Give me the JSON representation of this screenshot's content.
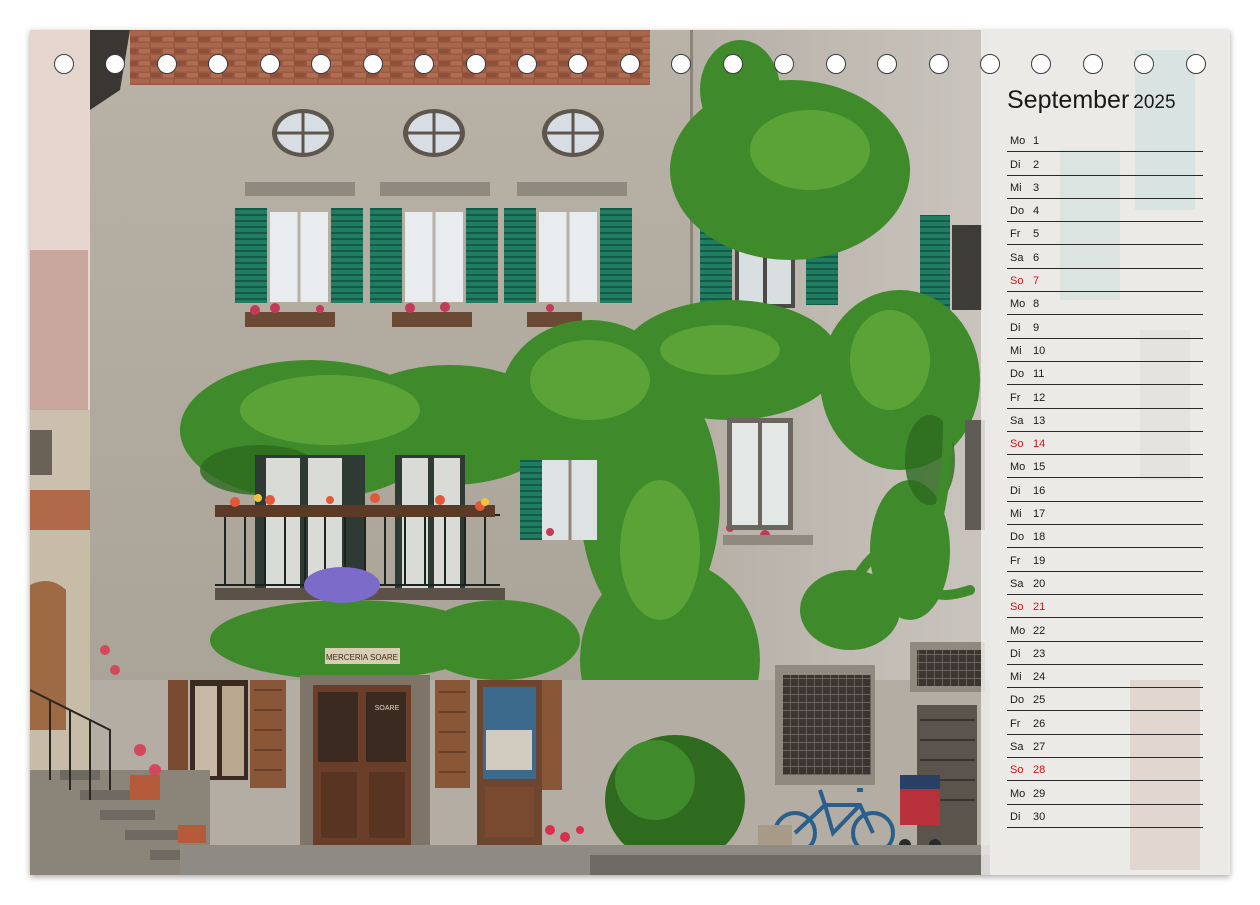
{
  "calendar": {
    "month": "September",
    "year": "2025",
    "days": [
      {
        "dow": "Mo",
        "num": "1"
      },
      {
        "dow": "Di",
        "num": "2"
      },
      {
        "dow": "Mi",
        "num": "3"
      },
      {
        "dow": "Do",
        "num": "4"
      },
      {
        "dow": "Fr",
        "num": "5"
      },
      {
        "dow": "Sa",
        "num": "6"
      },
      {
        "dow": "So",
        "num": "7",
        "sunday": true
      },
      {
        "dow": "Mo",
        "num": "8"
      },
      {
        "dow": "Di",
        "num": "9"
      },
      {
        "dow": "Mi",
        "num": "10"
      },
      {
        "dow": "Do",
        "num": "11"
      },
      {
        "dow": "Fr",
        "num": "12"
      },
      {
        "dow": "Sa",
        "num": "13"
      },
      {
        "dow": "So",
        "num": "14",
        "sunday": true
      },
      {
        "dow": "Mo",
        "num": "15"
      },
      {
        "dow": "Di",
        "num": "16"
      },
      {
        "dow": "Mi",
        "num": "17"
      },
      {
        "dow": "Do",
        "num": "18"
      },
      {
        "dow": "Fr",
        "num": "19"
      },
      {
        "dow": "Sa",
        "num": "20"
      },
      {
        "dow": "So",
        "num": "21",
        "sunday": true
      },
      {
        "dow": "Mo",
        "num": "22"
      },
      {
        "dow": "Di",
        "num": "23"
      },
      {
        "dow": "Mi",
        "num": "24"
      },
      {
        "dow": "Do",
        "num": "25"
      },
      {
        "dow": "Fr",
        "num": "26"
      },
      {
        "dow": "Sa",
        "num": "27"
      },
      {
        "dow": "So",
        "num": "28",
        "sunday": true
      },
      {
        "dow": "Mo",
        "num": "29"
      },
      {
        "dow": "Di",
        "num": "30"
      }
    ]
  },
  "photo": {
    "shop_sign": "MERCERIA SOARE",
    "door_sign": "SOARE"
  },
  "colors": {
    "sunday_red": "#d0121a",
    "shutter_green": "#1d7a5e",
    "ivy_green": "#3f8a2a",
    "door_brown": "#7a4a30"
  }
}
